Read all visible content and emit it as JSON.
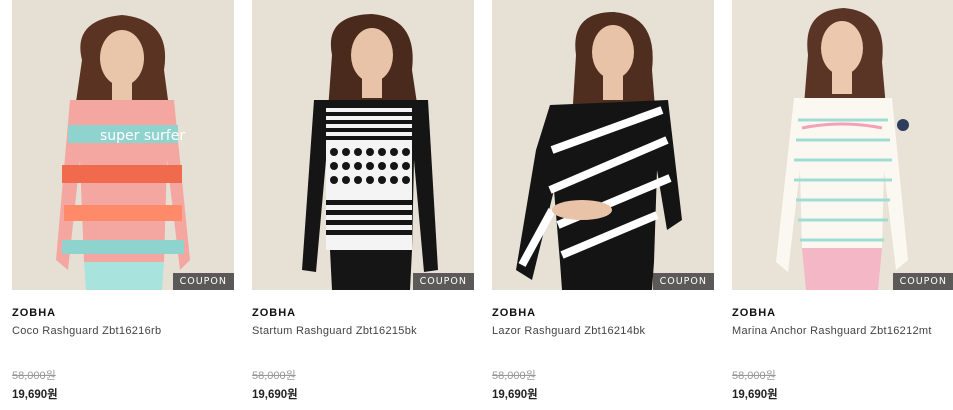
{
  "products": [
    {
      "brand": "ZOBHA",
      "name": "Coco Rashguard Zbt16216rb",
      "original_price": "58,000원",
      "price": "19,690원",
      "badge": "COUPON",
      "image": "coral-striped-rashguard",
      "print_text": "super surfer"
    },
    {
      "brand": "ZOBHA",
      "name": "Startum Rashguard Zbt16215bk",
      "original_price": "58,000원",
      "price": "19,690원",
      "badge": "COUPON",
      "image": "black-white-dot-rashguard"
    },
    {
      "brand": "ZOBHA",
      "name": "Lazor Rashguard Zbt16214bk",
      "original_price": "58,000원",
      "price": "19,690원",
      "badge": "COUPON",
      "image": "black-diagonal-stripe-rashguard"
    },
    {
      "brand": "ZOBHA",
      "name": "Marina Anchor Rashguard Zbt16212mt",
      "original_price": "58,000원",
      "price": "19,690원",
      "badge": "COUPON",
      "image": "mint-striped-rashguard"
    }
  ],
  "colors": {
    "backdrop": "#e8e2d8",
    "skin": "#e9c5aa",
    "hair": "#5a3322"
  }
}
